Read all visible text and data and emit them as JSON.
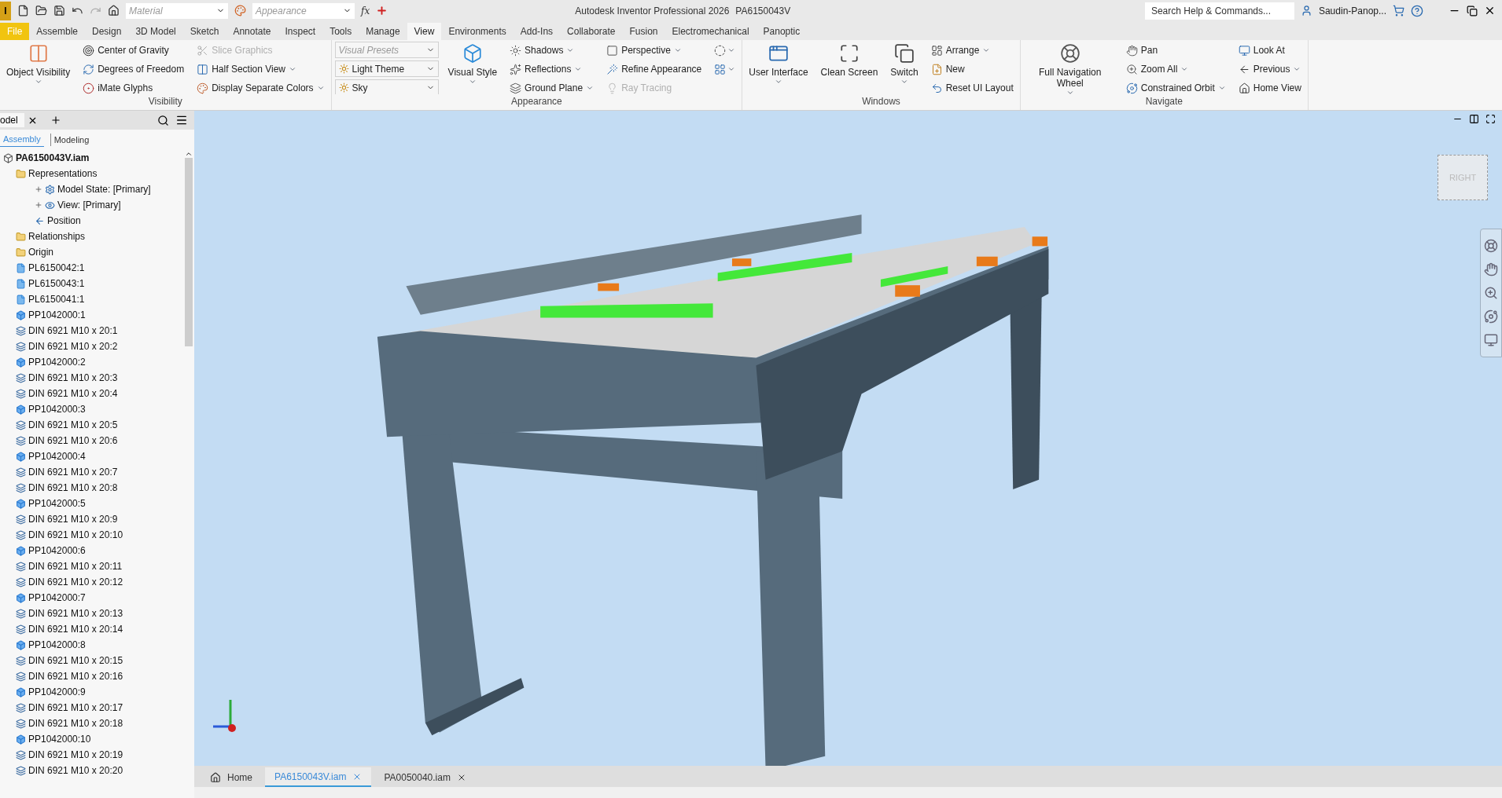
{
  "title_bar": {
    "app_logo": "I",
    "material": {
      "placeholder": "Material"
    },
    "appearance": {
      "placeholder": "Appearance"
    },
    "formula_glyph": "fx",
    "title": "Autodesk Inventor Professional 2026",
    "document": "PA6150043V",
    "search": {
      "placeholder": "Search Help & Commands..."
    },
    "user": "Saudin-Panop..."
  },
  "menu_tabs": [
    {
      "label": "File",
      "selected": false,
      "kind": "file"
    },
    {
      "label": "Assemble",
      "selected": false
    },
    {
      "label": "Design",
      "selected": false
    },
    {
      "label": "3D Model",
      "selected": false
    },
    {
      "label": "Sketch",
      "selected": false
    },
    {
      "label": "Annotate",
      "selected": false
    },
    {
      "label": "Inspect",
      "selected": false
    },
    {
      "label": "Tools",
      "selected": false
    },
    {
      "label": "Manage",
      "selected": false
    },
    {
      "label": "View",
      "selected": true
    },
    {
      "label": "Environments",
      "selected": false
    },
    {
      "label": "Add-Ins",
      "selected": false
    },
    {
      "label": "Collaborate",
      "selected": false
    },
    {
      "label": "Fusion",
      "selected": false
    },
    {
      "label": "Electromechanical",
      "selected": false
    },
    {
      "label": "Panoptic",
      "selected": false
    }
  ],
  "ribbon": {
    "panels": [
      {
        "title": "Visibility",
        "columns": [
          {
            "kind": "large",
            "items": [
              {
                "label": "Object Visibility",
                "dropdown": true
              }
            ]
          },
          {
            "kind": "stack",
            "items": [
              {
                "label": "Center of Gravity"
              },
              {
                "label": "Degrees of Freedom"
              },
              {
                "label": "iMate Glyphs"
              }
            ]
          },
          {
            "kind": "stack",
            "items": [
              {
                "label": "Slice Graphics",
                "disabled": true
              },
              {
                "label": "Half Section View",
                "disabled": false,
                "dropdown": true
              },
              {
                "label": "Display Separate Colors",
                "disabled": false,
                "dropdown": true
              }
            ]
          }
        ]
      },
      {
        "title": "Appearance",
        "columns": [
          {
            "kind": "combos",
            "items": [
              {
                "placeholder": "Visual Presets"
              },
              {
                "value": "Light Theme"
              },
              {
                "value": "Sky"
              }
            ]
          },
          {
            "kind": "large",
            "items": [
              {
                "label": "Visual Style",
                "dropdown": true
              }
            ]
          },
          {
            "kind": "stack",
            "items": [
              {
                "label": "Shadows",
                "dropdown": true
              },
              {
                "label": "Reflections",
                "dropdown": true
              },
              {
                "label": "Ground Plane",
                "dropdown": true
              }
            ]
          },
          {
            "kind": "stack",
            "items": [
              {
                "label": "Perspective",
                "disabled": false,
                "dropdown": true
              },
              {
                "label": "Refine Appearance",
                "disabled": false
              },
              {
                "label": "Ray Tracing",
                "disabled": true
              }
            ]
          },
          {
            "kind": "icons",
            "items": [
              {
                "dropdown": true
              },
              {
                "dropdown": true
              }
            ]
          }
        ]
      },
      {
        "title": "Windows",
        "columns": [
          {
            "kind": "large",
            "items": [
              {
                "label": "User Interface",
                "dropdown": true
              }
            ]
          },
          {
            "kind": "large",
            "items": [
              {
                "label": "Clean Screen"
              }
            ]
          },
          {
            "kind": "large",
            "items": [
              {
                "label": "Switch",
                "dropdown": true
              }
            ]
          },
          {
            "kind": "stack",
            "items": [
              {
                "label": "Arrange",
                "dropdown": true
              },
              {
                "label": "New"
              },
              {
                "label": "Reset UI Layout"
              }
            ]
          }
        ]
      },
      {
        "title": "Navigate",
        "columns": [
          {
            "kind": "large",
            "items": [
              {
                "label": "Full Navigation Wheel",
                "dropdown": true
              }
            ]
          },
          {
            "kind": "stack",
            "items": [
              {
                "label": "Pan"
              },
              {
                "label": "Zoom All",
                "dropdown": true
              },
              {
                "label": "Constrained Orbit",
                "dropdown": true
              }
            ]
          },
          {
            "kind": "stack",
            "items": [
              {
                "label": "Look At"
              },
              {
                "label": "Previous",
                "dropdown": true
              },
              {
                "label": "Home View"
              }
            ]
          }
        ]
      }
    ]
  },
  "browser": {
    "tab": "odel",
    "modes": [
      {
        "label": "Assembly",
        "selected": true
      },
      {
        "label": "Modeling",
        "selected": false
      }
    ],
    "tree": [
      {
        "label": "PA6150043V.iam",
        "kind": "assembly",
        "children": [
          {
            "label": "Representations",
            "kind": "folder",
            "children": [
              {
                "label": "Model State: [Primary]",
                "kind": "model-state",
                "expanded": false
              },
              {
                "label": "View: [Primary]",
                "kind": "view",
                "expanded": false
              },
              {
                "label": "Position",
                "kind": "position"
              }
            ]
          },
          {
            "label": "Relationships",
            "kind": "folder"
          },
          {
            "label": "Origin",
            "kind": "folder"
          },
          {
            "label": "PL6150042:1",
            "kind": "sheet"
          },
          {
            "label": "PL6150043:1",
            "kind": "sheet"
          },
          {
            "label": "PL6150041:1",
            "kind": "sheet"
          },
          {
            "label": "PP1042000:1",
            "kind": "part"
          },
          {
            "label": "DIN 6921 M10 x 20:1",
            "kind": "bolt"
          },
          {
            "label": "DIN 6921 M10 x 20:2",
            "kind": "bolt"
          },
          {
            "label": "PP1042000:2",
            "kind": "part"
          },
          {
            "label": "DIN 6921 M10 x 20:3",
            "kind": "bolt"
          },
          {
            "label": "DIN 6921 M10 x 20:4",
            "kind": "bolt"
          },
          {
            "label": "PP1042000:3",
            "kind": "part"
          },
          {
            "label": "DIN 6921 M10 x 20:5",
            "kind": "bolt"
          },
          {
            "label": "DIN 6921 M10 x 20:6",
            "kind": "bolt"
          },
          {
            "label": "PP1042000:4",
            "kind": "part"
          },
          {
            "label": "DIN 6921 M10 x 20:7",
            "kind": "bolt"
          },
          {
            "label": "DIN 6921 M10 x 20:8",
            "kind": "bolt"
          },
          {
            "label": "PP1042000:5",
            "kind": "part"
          },
          {
            "label": "DIN 6921 M10 x 20:9",
            "kind": "bolt"
          },
          {
            "label": "DIN 6921 M10 x 20:10",
            "kind": "bolt"
          },
          {
            "label": "PP1042000:6",
            "kind": "part"
          },
          {
            "label": "DIN 6921 M10 x 20:11",
            "kind": "bolt"
          },
          {
            "label": "DIN 6921 M10 x 20:12",
            "kind": "bolt"
          },
          {
            "label": "PP1042000:7",
            "kind": "part"
          },
          {
            "label": "DIN 6921 M10 x 20:13",
            "kind": "bolt"
          },
          {
            "label": "DIN 6921 M10 x 20:14",
            "kind": "bolt"
          },
          {
            "label": "PP1042000:8",
            "kind": "part"
          },
          {
            "label": "DIN 6921 M10 x 20:15",
            "kind": "bolt"
          },
          {
            "label": "DIN 6921 M10 x 20:16",
            "kind": "bolt"
          },
          {
            "label": "PP1042000:9",
            "kind": "part"
          },
          {
            "label": "DIN 6921 M10 x 20:17",
            "kind": "bolt"
          },
          {
            "label": "DIN 6921 M10 x 20:18",
            "kind": "bolt"
          },
          {
            "label": "PP1042000:10",
            "kind": "part"
          },
          {
            "label": "DIN 6921 M10 x 20:19",
            "kind": "bolt"
          },
          {
            "label": "DIN 6921 M10 x 20:20",
            "kind": "bolt"
          }
        ]
      }
    ]
  },
  "viewport": {
    "view_cube": "RIGHT"
  },
  "document_tabs": [
    {
      "label": "Home",
      "kind": "home",
      "selected": false
    },
    {
      "label": "PA6150043V.iam",
      "selected": true,
      "closable": true
    },
    {
      "label": "PA0050040.iam",
      "selected": false,
      "closable": true
    }
  ]
}
